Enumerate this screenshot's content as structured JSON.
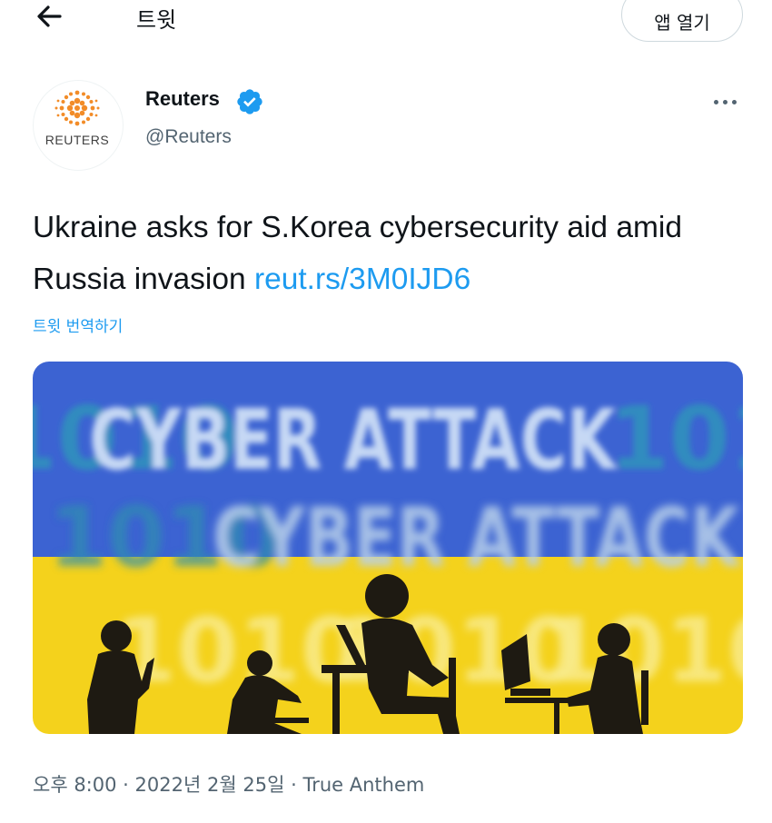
{
  "header": {
    "title": "트윗",
    "open_app_label": "앱 열기",
    "back_icon": "arrow-left-icon"
  },
  "author": {
    "name": "Reuters",
    "handle": "@Reuters",
    "avatar_text": "REUTERS",
    "verified_icon": "verified-badge-icon"
  },
  "tweet": {
    "text": "Ukraine asks for S.Korea cybersecurity aid amid Russia invasion",
    "link_text": "reut.rs/3M0IJD6",
    "translate_label": "트윗 번역하기"
  },
  "media": {
    "caption_text": "CYBER ATTACK",
    "binary_text": "1010"
  },
  "meta": {
    "time": "오후 8:00",
    "separator": "·",
    "date": "2022년 2월 25일",
    "app": "True Anthem"
  },
  "colors": {
    "accent": "#1d9bf0",
    "flag_blue": "#3c63d2",
    "flag_yellow": "#f4d21c",
    "brand_orange": "#f28c28",
    "text_primary": "#0f1419",
    "text_secondary": "#536471"
  }
}
